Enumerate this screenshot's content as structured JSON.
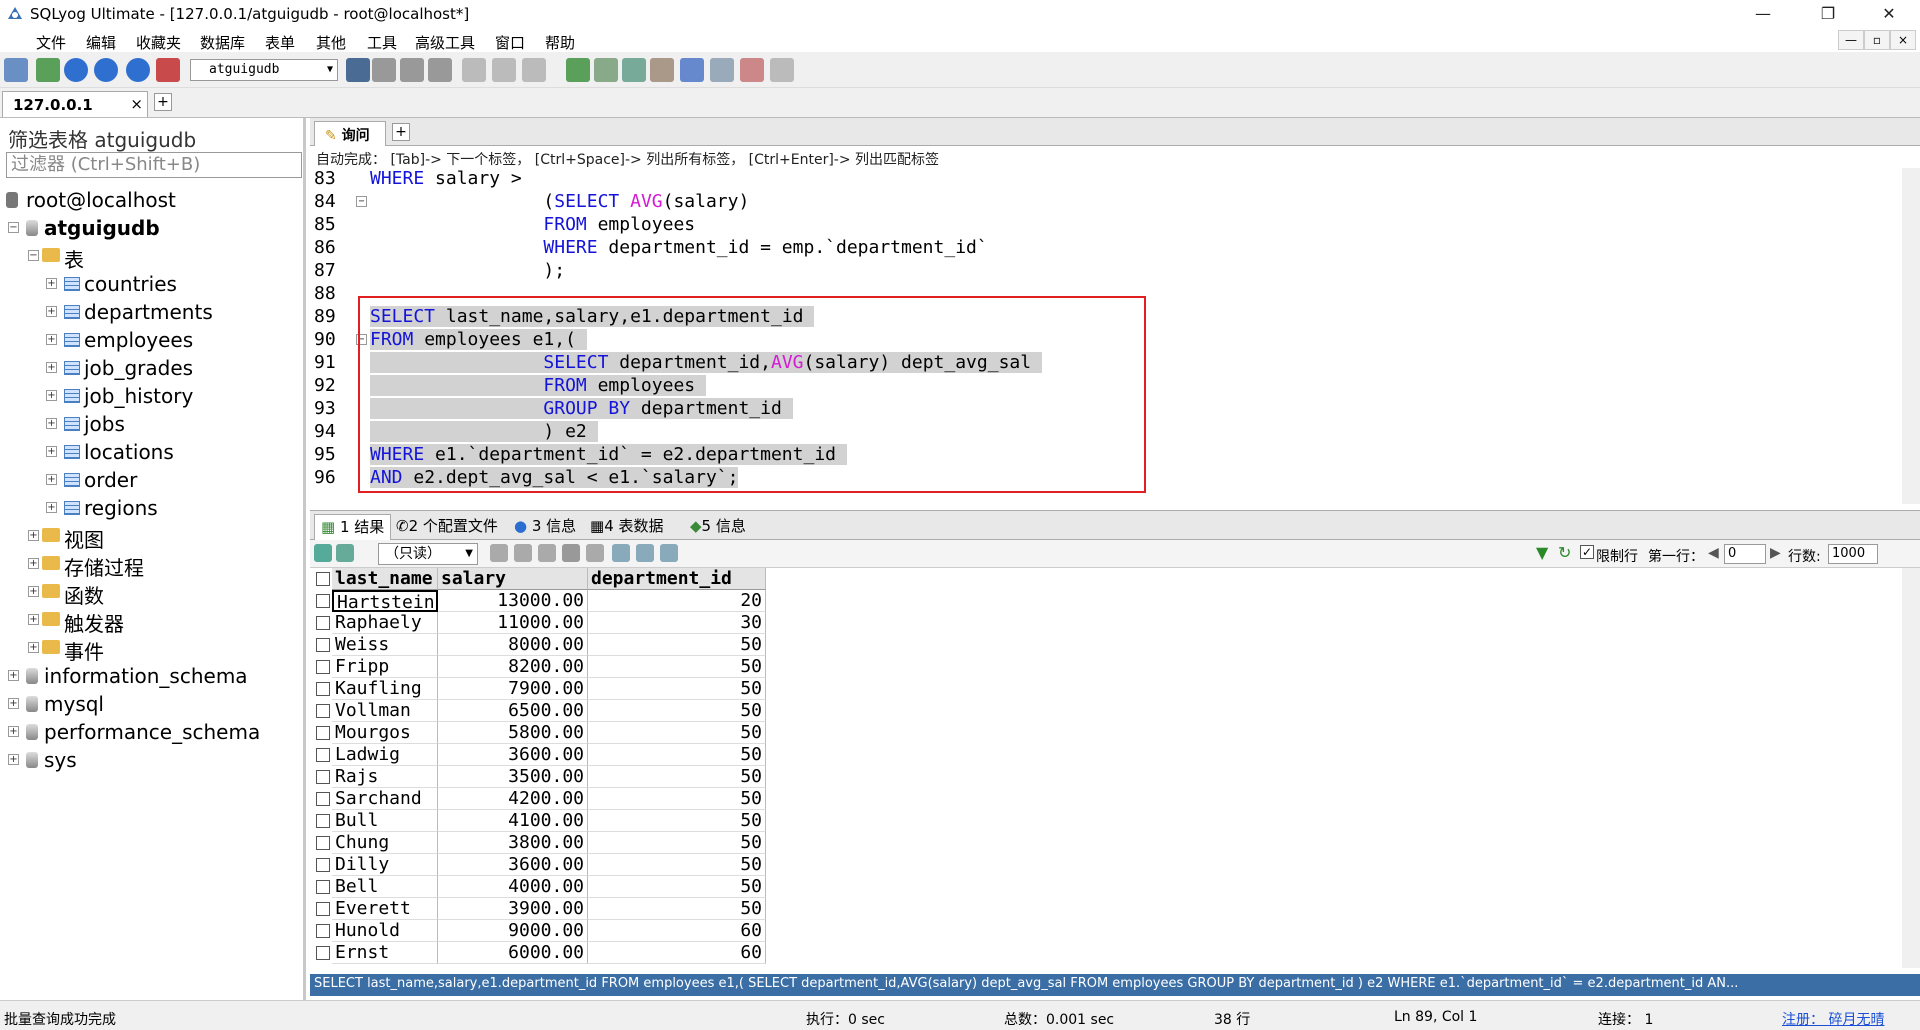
{
  "window": {
    "title": "SQLyog Ultimate - [127.0.0.1/atguigudb - root@localhost*]",
    "min": "—",
    "max": "❐",
    "close": "✕"
  },
  "menu": [
    "文件",
    "编辑",
    "收藏夹",
    "数据库",
    "表单",
    "其他",
    "工具",
    "高级工具",
    "窗口",
    "帮助"
  ],
  "mdi_buttons": [
    "—",
    "▫",
    "×"
  ],
  "toolbar": {
    "db_select": "atguigudb"
  },
  "connection_tab": {
    "label": "127.0.0.1",
    "close": "×",
    "add": "+"
  },
  "left": {
    "filter_label": "筛选表格 atguigudb",
    "filter_placeholder": "过滤器 (Ctrl+Shift+B)",
    "root": "root@localhost",
    "db": "atguigudb",
    "tables_folder": "表",
    "tables": [
      "countries",
      "departments",
      "employees",
      "job_grades",
      "job_history",
      "jobs",
      "locations",
      "order",
      "regions"
    ],
    "folders": [
      "视图",
      "存储过程",
      "函数",
      "触发器",
      "事件"
    ],
    "other_dbs": [
      "information_schema",
      "mysql",
      "performance_schema",
      "sys"
    ]
  },
  "query": {
    "tab_label": "询问",
    "add": "+",
    "autocomplete_hint": "自动完成： [Tab]-> 下一个标签， [Ctrl+Space]-> 列出所有标签， [Ctrl+Enter]-> 列出匹配标签",
    "line_numbers": [
      "83",
      "84",
      "85",
      "86",
      "87",
      "88",
      "89",
      "90",
      "91",
      "92",
      "93",
      "94",
      "95",
      "96"
    ]
  },
  "results": {
    "tabs": [
      "1 结果",
      "2 个配置文件",
      "3 信息",
      "4 表数据",
      "5 信息"
    ],
    "readonly": "（只读）",
    "limit_label": "限制行",
    "first_row_label": "第一行：",
    "first_row_value": "0",
    "rows_label": "行数:",
    "rows_value": "1000",
    "columns": [
      "last_name",
      "salary",
      "department_id"
    ],
    "rows": [
      [
        "Hartstein",
        "13000.00",
        "20"
      ],
      [
        "Raphaely",
        "11000.00",
        "30"
      ],
      [
        "Weiss",
        "8000.00",
        "50"
      ],
      [
        "Fripp",
        "8200.00",
        "50"
      ],
      [
        "Kaufling",
        "7900.00",
        "50"
      ],
      [
        "Vollman",
        "6500.00",
        "50"
      ],
      [
        "Mourgos",
        "5800.00",
        "50"
      ],
      [
        "Ladwig",
        "3600.00",
        "50"
      ],
      [
        "Rajs",
        "3500.00",
        "50"
      ],
      [
        "Sarchand",
        "4200.00",
        "50"
      ],
      [
        "Bull",
        "4100.00",
        "50"
      ],
      [
        "Chung",
        "3800.00",
        "50"
      ],
      [
        "Dilly",
        "3600.00",
        "50"
      ],
      [
        "Bell",
        "4000.00",
        "50"
      ],
      [
        "Everett",
        "3900.00",
        "50"
      ],
      [
        "Hunold",
        "9000.00",
        "60"
      ],
      [
        "Ernst",
        "6000.00",
        "60"
      ]
    ]
  },
  "sql_bar": "SELECT last_name,salary,e1.department_id FROM employees e1,( SELECT department_id,AVG(salary) dept_avg_sal FROM employees GROUP BY department_id ) e2 WHERE e1.`department_id` = e2.department_id AN...",
  "status": {
    "msg": "批量查询成功完成",
    "exec": "执行：0 sec",
    "total": "总数：0.001 sec",
    "rows": "38 行",
    "pos": "Ln 89, Col 1",
    "conn": "连接： 1",
    "reg": "注册： 碎月无晴"
  }
}
